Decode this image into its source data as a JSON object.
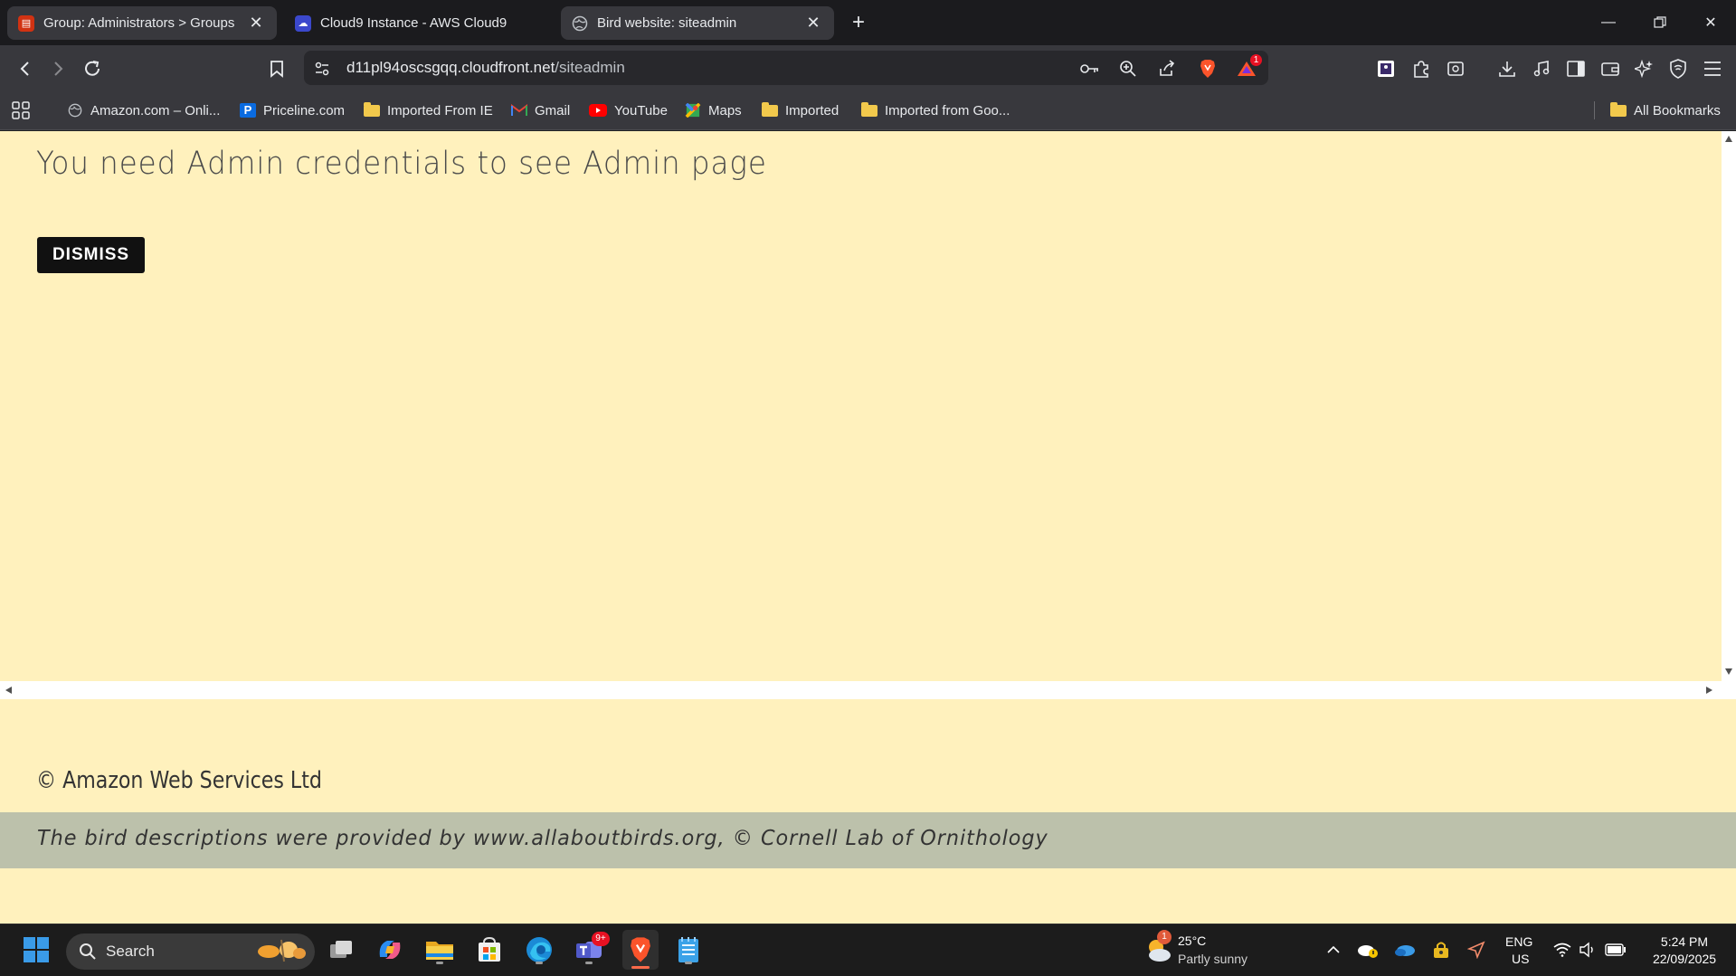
{
  "browser": {
    "tabs": [
      {
        "title": "Group: Administrators > Groups",
        "icon": "aws-iam-icon"
      },
      {
        "title": "Cloud9 Instance - AWS Cloud9",
        "icon": "cloud9-icon"
      },
      {
        "title": "Bird website: siteadmin",
        "icon": "globe-icon"
      }
    ],
    "address": {
      "host": "d11pl94oscsgqq.cloudfront.net",
      "path": "/siteadmin"
    },
    "shield_badge": "1",
    "bookmarks": [
      {
        "label": "Amazon.com – Onli...",
        "icon": "globe-icon"
      },
      {
        "label": "Priceline.com",
        "icon": "priceline-icon"
      },
      {
        "label": "Imported From IE",
        "icon": "folder-icon"
      },
      {
        "label": "Gmail",
        "icon": "gmail-icon"
      },
      {
        "label": "YouTube",
        "icon": "youtube-icon"
      },
      {
        "label": "Maps",
        "icon": "maps-icon"
      },
      {
        "label": "Imported",
        "icon": "folder-icon"
      },
      {
        "label": "Imported from Goo...",
        "icon": "folder-icon"
      }
    ],
    "all_bookmarks": "All Bookmarks"
  },
  "page": {
    "heading": "You need Admin credentials to see Admin page",
    "dismiss_label": "DISMISS",
    "copyright": "© Amazon Web Services Ltd",
    "credits": "The bird descriptions were provided by www.allaboutbirds.org, © Cornell Lab of Ornithology",
    "colors": {
      "background": "#fff1bd",
      "credits_band": "#bcc1ab",
      "button": "#111111"
    }
  },
  "taskbar": {
    "search_label": "Search",
    "teams_badge": "9+",
    "weather": {
      "temp": "25°C",
      "condition": "Partly sunny",
      "badge": "1"
    },
    "language": {
      "line1": "ENG",
      "line2": "US"
    },
    "clock": {
      "time": "5:24 PM",
      "date": "22/09/2025"
    }
  }
}
